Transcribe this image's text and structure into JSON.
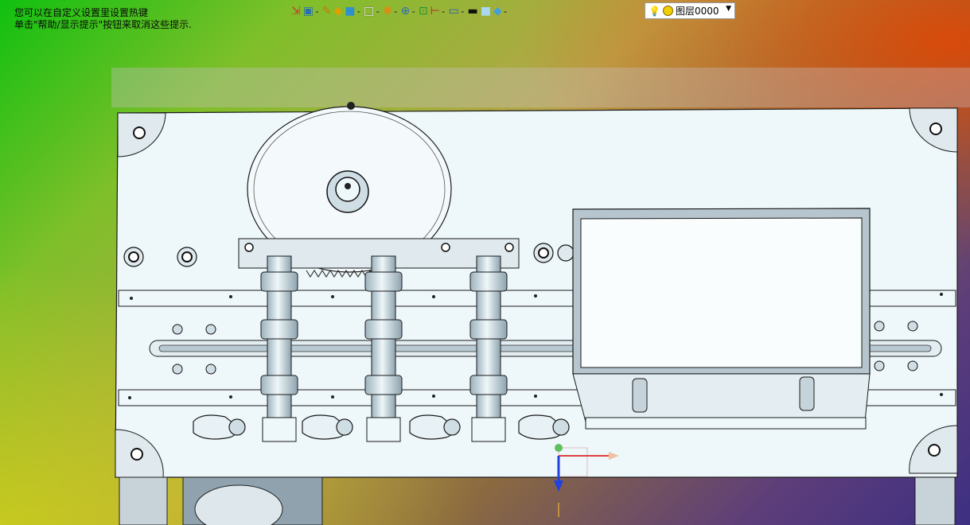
{
  "hints": {
    "line1": "您可以在自定义设置里设置热键",
    "line2": "单击\"帮助/显示提示\"按钮来取消这些提示."
  },
  "toolbar": {
    "buttons": [
      {
        "name": "exit-sketch-icon",
        "glyph": "⇲",
        "color": "#d03030",
        "caret": false
      },
      {
        "name": "view-orientation-icon",
        "glyph": "▣",
        "color": "#2a6fb0",
        "caret": true
      },
      {
        "name": "sketch-pen-icon",
        "glyph": "✎",
        "color": "#c07a00",
        "caret": false
      },
      {
        "name": "extrude-icon",
        "glyph": "◆",
        "color": "#e0a000",
        "caret": false
      },
      {
        "name": "view-cube-icon",
        "glyph": "■",
        "color": "#2f8fd0",
        "caret": true
      },
      {
        "name": "display-style-icon",
        "glyph": "□",
        "color": "#f5f5f5",
        "caret": true
      },
      {
        "name": "section-view-icon",
        "glyph": "✺",
        "color": "#e08a10",
        "caret": true
      },
      {
        "name": "zoom-icon",
        "glyph": "⊕",
        "color": "#2a70b8",
        "caret": true
      },
      {
        "name": "zoom-fit-icon",
        "glyph": "⊡",
        "color": "#2a9030",
        "caret": false
      },
      {
        "name": "dimension-icon",
        "glyph": "⊢",
        "color": "#c02020",
        "caret": true
      },
      {
        "name": "monitor-icon",
        "glyph": "▭",
        "color": "#2a60b0",
        "caret": true
      },
      {
        "name": "line-color-icon",
        "glyph": "▬",
        "color": "#111111",
        "caret": false
      },
      {
        "name": "fill-color-icon",
        "glyph": "■",
        "color": "#a8d8f0",
        "caret": false
      },
      {
        "name": "layer-tool-icon",
        "glyph": "◆",
        "color": "#40a0d8",
        "caret": true
      }
    ],
    "layer_label": "图层0000"
  },
  "colors": {
    "part": "#eef7fa",
    "part_shade": "#bccdd6",
    "edge": "#1a1a1a",
    "axis_x": "#e04040",
    "axis_y": "#20a020",
    "axis_z": "#2040e0"
  }
}
